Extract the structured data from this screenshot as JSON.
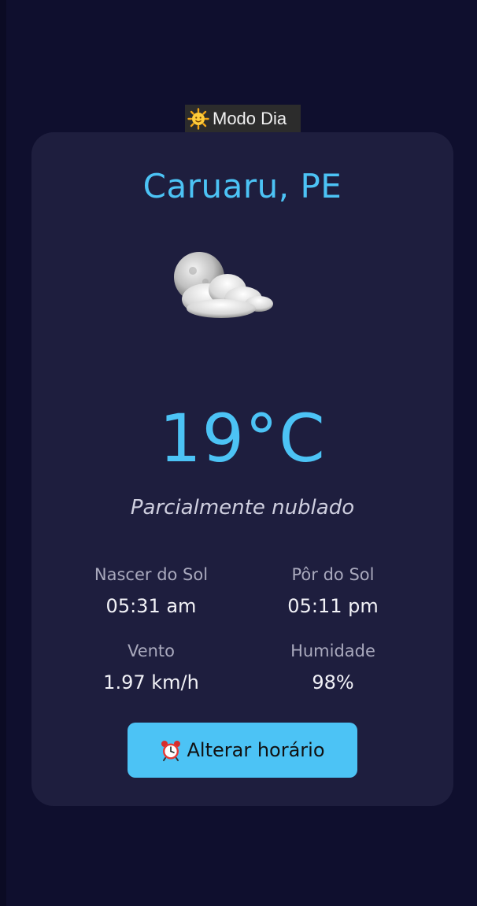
{
  "mode_toggle": {
    "label": "Modo Dia",
    "icon": "sun-face-icon"
  },
  "weather": {
    "city": "Caruaru, PE",
    "icon": "partly-cloudy-night-icon",
    "temperature": "19°C",
    "description": "Parcialmente nublado"
  },
  "stats": [
    {
      "label": "Nascer do Sol",
      "value": "05:31 am"
    },
    {
      "label": "Pôr do Sol",
      "value": "05:11 pm"
    },
    {
      "label": "Vento",
      "value": "1.97 km/h"
    },
    {
      "label": "Humidade",
      "value": "98%"
    }
  ],
  "change_time_button": {
    "label": "Alterar horário",
    "icon": "alarm-clock-icon"
  },
  "colors": {
    "background": "#0f0f2e",
    "card": "#1e1e3e",
    "accent": "#4cc3f5"
  }
}
